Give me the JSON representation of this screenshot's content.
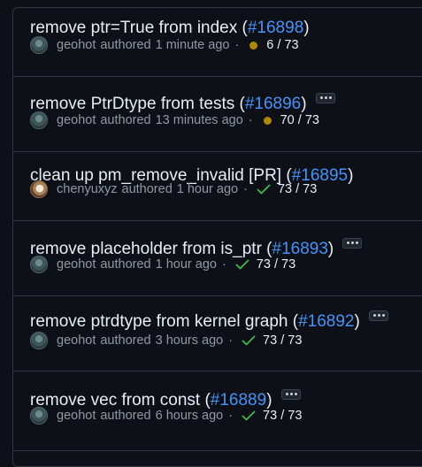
{
  "commits": [
    {
      "title": "remove ptr=True from index",
      "pr": "#16898",
      "has_more": false,
      "author": "geohot",
      "avatar": "geohot",
      "authored": "authored",
      "time": "1 minute ago",
      "status": "pending",
      "checks": "6 / 73"
    },
    {
      "title": "remove PtrDtype from tests",
      "pr": "#16896",
      "has_more": true,
      "author": "geohot",
      "avatar": "geohot",
      "authored": "authored",
      "time": "13 minutes ago",
      "status": "pending",
      "checks": "70 / 73"
    },
    {
      "title": "clean up pm_remove_invalid [PR]",
      "pr": "#16895",
      "has_more": false,
      "author": "chenyuxyz",
      "avatar": "chenyu",
      "authored": "authored",
      "time": "1 hour ago",
      "status": "success",
      "checks": "73 / 73"
    },
    {
      "title": "remove placeholder from is_ptr",
      "pr": "#16893",
      "has_more": true,
      "author": "geohot",
      "avatar": "geohot",
      "authored": "authored",
      "time": "1 hour ago",
      "status": "success",
      "checks": "73 / 73"
    },
    {
      "title": "remove ptrdtype from kernel graph",
      "pr": "#16892",
      "has_more": true,
      "author": "geohot",
      "avatar": "geohot",
      "authored": "authored",
      "time": "3 hours ago",
      "status": "success",
      "checks": "73 / 73"
    },
    {
      "title": "remove vec from const",
      "pr": "#16889",
      "has_more": true,
      "author": "geohot",
      "avatar": "geohot",
      "authored": "authored",
      "time": "6 hours ago",
      "status": "success",
      "checks": "73 / 73"
    }
  ],
  "punct": {
    "open": " (",
    "close": ")",
    "dot": "·"
  },
  "colors": {
    "pending": "#b08800",
    "success": "#3fb950",
    "link": "#4493f8"
  },
  "icons": {
    "pending": "status-dot-icon",
    "success": "check-icon",
    "more": "ellipsis-icon"
  }
}
